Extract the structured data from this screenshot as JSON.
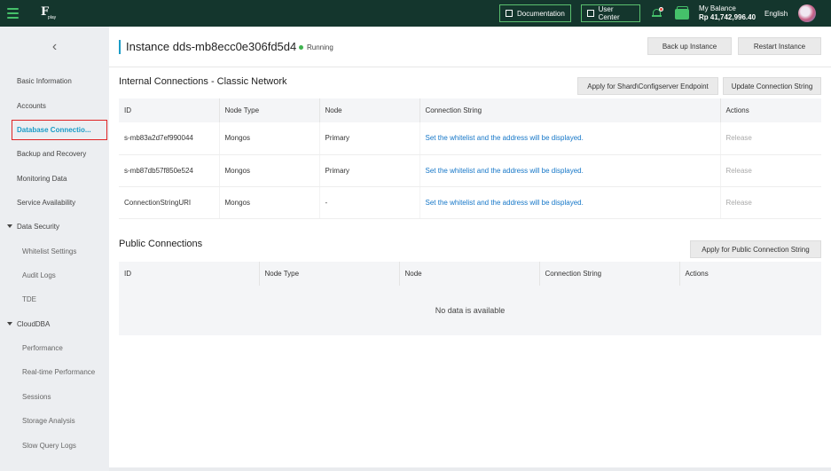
{
  "topbar": {
    "logo_text": "F",
    "logo_sub": "play",
    "documentation": "Documentation",
    "user_center": "User Center",
    "balance_label": "My Balance",
    "balance_value": "Rp 41,742,996.40",
    "language": "English"
  },
  "sidebar": {
    "collapse_glyph": "‹",
    "items": [
      {
        "label": "Basic Information"
      },
      {
        "label": "Accounts"
      },
      {
        "label": "Database Connectio..."
      },
      {
        "label": "Backup and Recovery"
      },
      {
        "label": "Monitoring Data"
      },
      {
        "label": "Service Availability"
      },
      {
        "label": "Data Security"
      },
      {
        "label": "Whitelist Settings"
      },
      {
        "label": "Audit Logs"
      },
      {
        "label": "TDE"
      },
      {
        "label": "CloudDBA"
      },
      {
        "label": "Performance"
      },
      {
        "label": "Real-time Performance"
      },
      {
        "label": "Sessions"
      },
      {
        "label": "Storage Analysis"
      },
      {
        "label": "Slow Query Logs"
      }
    ]
  },
  "header": {
    "title": "Instance dds-mb8ecc0e306fd5d4",
    "status": "Running",
    "backup_button": "Back up Instance",
    "restart_button": "Restart Instance"
  },
  "internal": {
    "title": "Internal Connections - Classic Network",
    "apply_shard": "Apply for Shard\\Configserver Endpoint",
    "update_string": "Update Connection String",
    "columns": [
      "ID",
      "Node Type",
      "Node",
      "Connection String",
      "Actions"
    ],
    "rows": [
      {
        "id": "s-mb83a2d7ef990044",
        "node_type": "Mongos",
        "node": "Primary",
        "conn": "Set the whitelist and the address will be displayed.",
        "action": "Release"
      },
      {
        "id": "s-mb87db57f850e524",
        "node_type": "Mongos",
        "node": "Primary",
        "conn": "Set the whitelist and the address will be displayed.",
        "action": "Release"
      },
      {
        "id": "ConnectionStringURI",
        "node_type": "Mongos",
        "node": "-",
        "conn": "Set the whitelist and the address will be displayed.",
        "action": "Release"
      }
    ]
  },
  "public": {
    "title": "Public Connections",
    "apply_public": "Apply for Public Connection String",
    "columns": [
      "ID",
      "Node Type",
      "Node",
      "Connection String",
      "Actions"
    ],
    "empty_text": "No data is available"
  },
  "colors": {
    "topbar": "#14362d",
    "accent_green": "#45c06a",
    "link_blue": "#1677c8",
    "active_blue": "#1b9cc7",
    "highlight_red": "#e02424"
  }
}
